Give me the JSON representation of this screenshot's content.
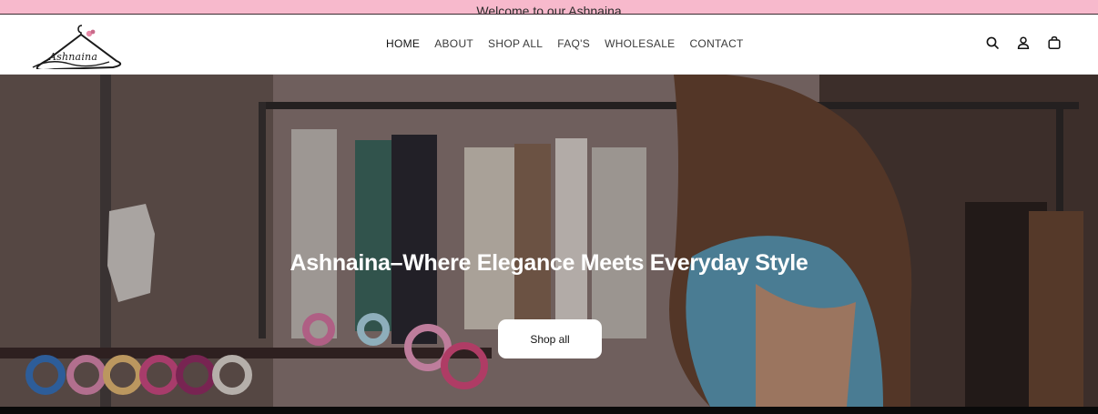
{
  "announcement": {
    "text": "Welcome to our Ashnaina"
  },
  "header": {
    "logo_text": "Ashnaina",
    "nav": [
      "HOME",
      "ABOUT",
      "SHOP ALL",
      "FAQ'S",
      "WHOLESALE",
      "CONTACT"
    ],
    "icons": [
      "search-icon",
      "account-icon",
      "cart-icon"
    ]
  },
  "hero": {
    "title": "Ashnaina–Where Elegance Meets Everyday Style",
    "button_label": "Shop all"
  },
  "colors": {
    "announcement_bg": "#f7b9cc",
    "logo_accent": "#e88aa8"
  }
}
